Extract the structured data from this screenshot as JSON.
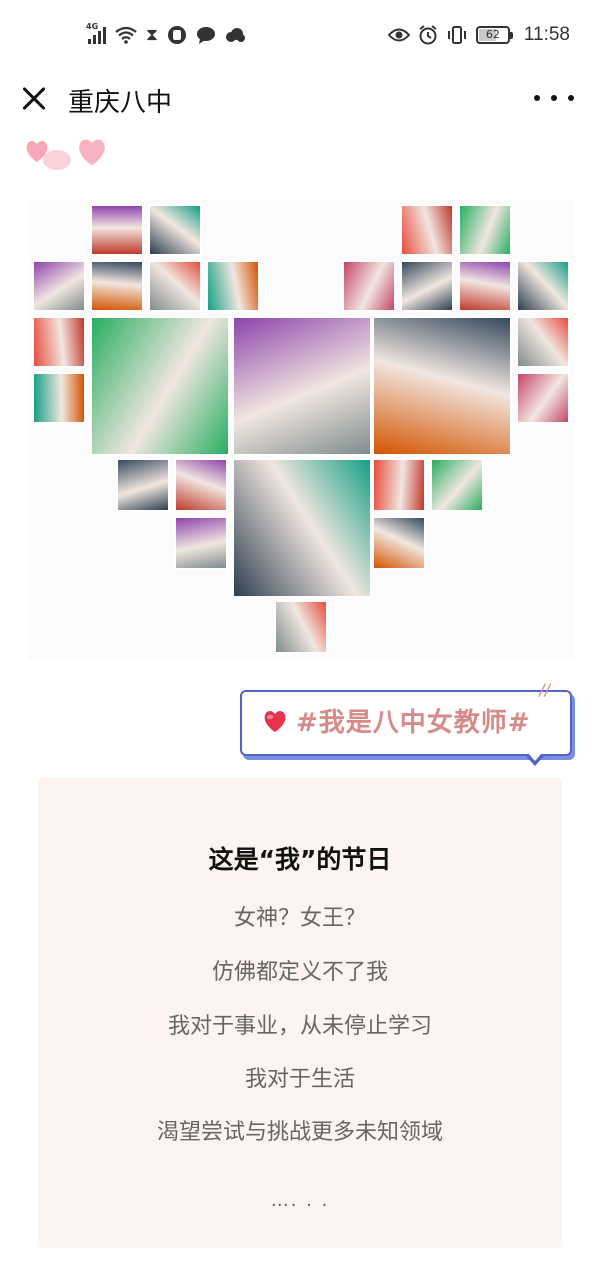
{
  "status_bar": {
    "network": "4G",
    "battery": "62",
    "battery_level": 0.62,
    "time": "11:58",
    "left_icons": [
      "signal-icon",
      "wifi-icon",
      "hourglass-icon",
      "phone-icon",
      "chat-icon",
      "cloud-icon"
    ],
    "right_icons": [
      "eye-icon",
      "alarm-icon",
      "vibrate-icon",
      "battery-icon"
    ]
  },
  "nav": {
    "title": "重庆八中",
    "close_icon": "close-icon",
    "more_icon": "more-icon"
  },
  "photo_heart": {
    "caption": "",
    "palette": [
      "#c0392b",
      "#2c3e50",
      "#e74c3c",
      "#27ae60",
      "#8e44ad",
      "#d35400",
      "#7f8c8d",
      "#16a085",
      "#c44569",
      "#34495e"
    ]
  },
  "hashtag": {
    "text": "#我是八中女教师#",
    "accent": "#d68a8a",
    "border": "#5064c8"
  },
  "card": {
    "heading": "这是“我”的节日",
    "lines": [
      "女神？女王？",
      "仿佛都定义不了我",
      "我对于事业，从未停止学习",
      "我对于生活",
      "渴望尝试与挑战更多未知领域"
    ],
    "ellipsis": "…. . .",
    "background": "#fdf3f0"
  }
}
